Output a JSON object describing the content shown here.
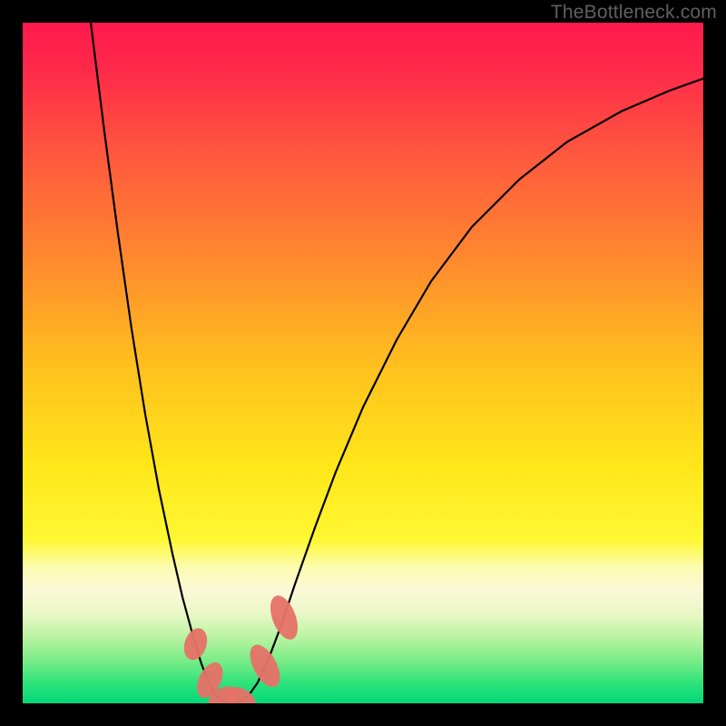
{
  "attribution": "TheBottleneck.com",
  "chart_data": {
    "type": "line",
    "title": "",
    "xlabel": "",
    "ylabel": "",
    "xlim": [
      0,
      100
    ],
    "ylim": [
      0,
      100
    ],
    "background_gradient": {
      "stops": [
        {
          "offset": 0.0,
          "color": "#ff1a4d"
        },
        {
          "offset": 0.07,
          "color": "#ff2a4a"
        },
        {
          "offset": 0.2,
          "color": "#ff5a3d"
        },
        {
          "offset": 0.35,
          "color": "#ff8a2e"
        },
        {
          "offset": 0.5,
          "color": "#ffbf1e"
        },
        {
          "offset": 0.65,
          "color": "#ffe61a"
        },
        {
          "offset": 0.76,
          "color": "#fff833"
        },
        {
          "offset": 0.8,
          "color": "#fcfcb0"
        },
        {
          "offset": 0.835,
          "color": "#fbf8d8"
        },
        {
          "offset": 0.87,
          "color": "#e8f8c4"
        },
        {
          "offset": 0.905,
          "color": "#b6f3a0"
        },
        {
          "offset": 0.94,
          "color": "#74ec87"
        },
        {
          "offset": 0.97,
          "color": "#2fe37a"
        },
        {
          "offset": 1.0,
          "color": "#00d878"
        }
      ]
    },
    "series": [
      {
        "name": "curve",
        "stroke": "#000000",
        "stroke_width": 2.2,
        "points": [
          {
            "x": 10.0,
            "y": 100.0
          },
          {
            "x": 12.0,
            "y": 84.0
          },
          {
            "x": 14.0,
            "y": 69.0
          },
          {
            "x": 16.0,
            "y": 55.0
          },
          {
            "x": 18.0,
            "y": 42.5
          },
          {
            "x": 20.0,
            "y": 31.5
          },
          {
            "x": 22.0,
            "y": 22.0
          },
          {
            "x": 23.5,
            "y": 15.5
          },
          {
            "x": 25.0,
            "y": 10.0
          },
          {
            "x": 26.2,
            "y": 6.0
          },
          {
            "x": 27.3,
            "y": 3.0
          },
          {
            "x": 28.3,
            "y": 1.2
          },
          {
            "x": 29.3,
            "y": 0.3
          },
          {
            "x": 30.3,
            "y": 0.0
          },
          {
            "x": 31.3,
            "y": 0.0
          },
          {
            "x": 32.3,
            "y": 0.4
          },
          {
            "x": 33.3,
            "y": 1.3
          },
          {
            "x": 34.5,
            "y": 3.0
          },
          {
            "x": 36.0,
            "y": 6.2
          },
          {
            "x": 38.0,
            "y": 11.5
          },
          {
            "x": 40.0,
            "y": 17.5
          },
          {
            "x": 43.0,
            "y": 26.0
          },
          {
            "x": 46.0,
            "y": 34.0
          },
          {
            "x": 50.0,
            "y": 43.5
          },
          {
            "x": 55.0,
            "y": 53.5
          },
          {
            "x": 60.0,
            "y": 62.0
          },
          {
            "x": 66.0,
            "y": 70.0
          },
          {
            "x": 73.0,
            "y": 77.0
          },
          {
            "x": 80.0,
            "y": 82.5
          },
          {
            "x": 88.0,
            "y": 87.0
          },
          {
            "x": 95.0,
            "y": 90.0
          },
          {
            "x": 100.0,
            "y": 91.8
          }
        ]
      }
    ],
    "markers": [
      {
        "name": "left-descent-top",
        "x": 25.4,
        "y": 8.7,
        "rx": 1.6,
        "ry": 2.4,
        "rot": 18
      },
      {
        "name": "left-descent-mid",
        "x": 27.5,
        "y": 3.4,
        "rx": 1.6,
        "ry": 2.8,
        "rot": 26
      },
      {
        "name": "bottom-left",
        "x": 29.4,
        "y": 0.6,
        "rx": 1.6,
        "ry": 2.4,
        "rot": 55
      },
      {
        "name": "bottom-right",
        "x": 32.1,
        "y": 0.5,
        "rx": 1.6,
        "ry": 2.4,
        "rot": -55
      },
      {
        "name": "right-ascent-low",
        "x": 35.6,
        "y": 5.5,
        "rx": 1.7,
        "ry": 3.4,
        "rot": -28
      },
      {
        "name": "right-ascent-high",
        "x": 38.4,
        "y": 12.6,
        "rx": 1.7,
        "ry": 3.4,
        "rot": -21
      }
    ],
    "marker_style": {
      "fill": "#e57368",
      "opacity": 0.96
    }
  }
}
